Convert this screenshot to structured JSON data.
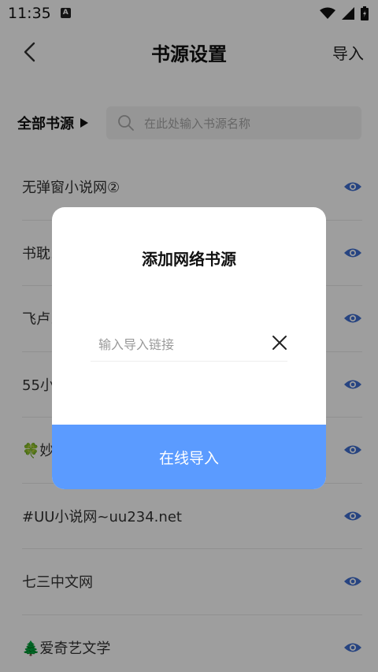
{
  "status_bar": {
    "time": "11:35",
    "notification_icon": "A"
  },
  "header": {
    "title": "书源设置",
    "import_label": "导入"
  },
  "filter": {
    "label": "全部书源",
    "search_placeholder": "在此处输入书源名称"
  },
  "sources": [
    {
      "label": "无弹窗小说网②"
    },
    {
      "label": "书耽..."
    },
    {
      "label": "飞卢..."
    },
    {
      "label": "55小..."
    },
    {
      "label": "🍀妙..."
    },
    {
      "label": "#UU小说网~uu234.net"
    },
    {
      "label": "七三中文网"
    },
    {
      "label": "🌲爱奇艺文学"
    }
  ],
  "dialog": {
    "title": "添加网络书源",
    "input_placeholder": "输入导入链接",
    "confirm_label": "在线导入"
  },
  "colors": {
    "accent": "#5b9bff",
    "eye": "#3f6fd1"
  }
}
